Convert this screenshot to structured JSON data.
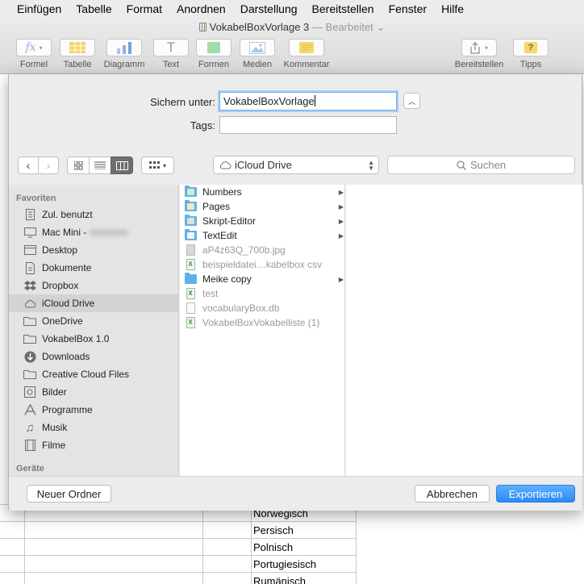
{
  "menubar": {
    "items": [
      "Einfügen",
      "Tabelle",
      "Format",
      "Anordnen",
      "Darstellung",
      "Bereitstellen",
      "Fenster",
      "Hilfe"
    ]
  },
  "window": {
    "title": "VokabelBoxVorlage 3",
    "separator": "—",
    "status": "Bearbeitet"
  },
  "toolbar": {
    "formel": "Formel",
    "tabelle": "Tabelle",
    "diagramm": "Diagramm",
    "text": "Text",
    "formen": "Formen",
    "medien": "Medien",
    "kommentar": "Kommentar",
    "bereitstellen": "Bereitstellen",
    "tipps": "Tipps"
  },
  "sheet": {
    "cells": [
      "Norwegisch",
      "Persisch",
      "Polnisch",
      "Portugiesisch",
      "Rumänisch"
    ]
  },
  "dialog": {
    "save_as_label": "Sichern unter:",
    "save_as_value": "VokabelBoxVorlage",
    "tags_label": "Tags:",
    "tags_value": "",
    "location": "iCloud Drive",
    "search_placeholder": "Suchen",
    "sidebar": {
      "favorites_header": "Favoriten",
      "devices_header": "Geräte",
      "items": [
        {
          "label": "Zul. benutzt",
          "icon": "recents-icon"
        },
        {
          "label": "Mac Mini -",
          "icon": "computer-icon"
        },
        {
          "label": "Desktop",
          "icon": "desktop-icon"
        },
        {
          "label": "Dokumente",
          "icon": "documents-icon"
        },
        {
          "label": "Dropbox",
          "icon": "dropbox-icon"
        },
        {
          "label": "iCloud Drive",
          "icon": "cloud-icon"
        },
        {
          "label": "OneDrive",
          "icon": "folder-icon"
        },
        {
          "label": "VokabelBox 1.0",
          "icon": "folder-icon"
        },
        {
          "label": "Downloads",
          "icon": "downloads-icon"
        },
        {
          "label": "Creative Cloud Files",
          "icon": "folder-icon"
        },
        {
          "label": "Bilder",
          "icon": "pictures-icon"
        },
        {
          "label": "Programme",
          "icon": "applications-icon"
        },
        {
          "label": "Musik",
          "icon": "music-icon"
        },
        {
          "label": "Filme",
          "icon": "movies-icon"
        }
      ]
    },
    "files": [
      {
        "name": "Numbers",
        "kind": "app-folder",
        "arrow": true,
        "dim": false
      },
      {
        "name": "Pages",
        "kind": "app-folder",
        "arrow": true,
        "dim": false
      },
      {
        "name": "Skript-Editor",
        "kind": "app-folder",
        "arrow": true,
        "dim": false
      },
      {
        "name": "TextEdit",
        "kind": "app-folder",
        "arrow": true,
        "dim": false
      },
      {
        "name": "aP4z63Q_700b.jpg",
        "kind": "file",
        "arrow": false,
        "dim": true
      },
      {
        "name": "beispieldatei…kabelbox csv",
        "kind": "sheet",
        "arrow": false,
        "dim": true
      },
      {
        "name": "Meike copy",
        "kind": "folder",
        "arrow": true,
        "dim": false
      },
      {
        "name": "test",
        "kind": "sheet",
        "arrow": false,
        "dim": true
      },
      {
        "name": "vocabularyBox.db",
        "kind": "file",
        "arrow": false,
        "dim": true
      },
      {
        "name": "VokabelBoxVokabelliste (1)",
        "kind": "sheet",
        "arrow": false,
        "dim": true
      }
    ],
    "new_folder": "Neuer Ordner",
    "cancel": "Abbrechen",
    "export": "Exportieren"
  }
}
